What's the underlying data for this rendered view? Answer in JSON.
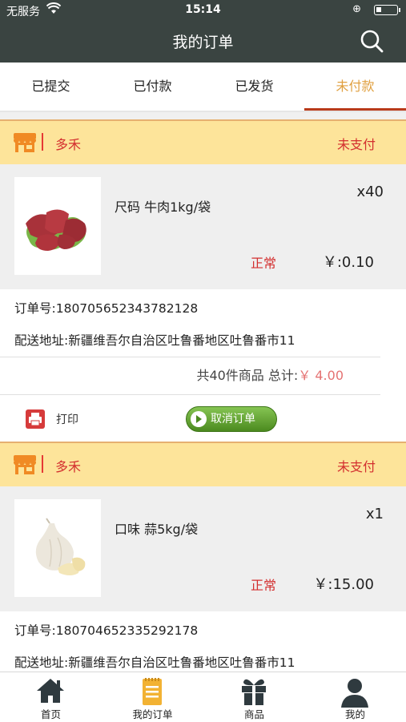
{
  "status_bar": {
    "carrier": "无服务",
    "time": "15:14"
  },
  "header": {
    "title": "我的订单"
  },
  "tabs": [
    {
      "label": "已提交"
    },
    {
      "label": "已付款"
    },
    {
      "label": "已发货"
    },
    {
      "label": "未付款"
    }
  ],
  "orders": [
    {
      "store_name": "多禾",
      "pay_status": "未支付",
      "spec": "尺码 牛肉1kg/袋",
      "quantity": "x40",
      "state": "正常",
      "price": "￥:0.10",
      "order_no": "订单号:180705652343782128",
      "address": "配送地址:新疆维吾尔自治区吐鲁番地区吐鲁番市11",
      "total_prefix": "共40件商品 总计:",
      "total_amount": "￥ 4.00",
      "print_label": "打印",
      "cancel_label": "取消订单"
    },
    {
      "store_name": "多禾",
      "pay_status": "未支付",
      "spec": "口味 蒜5kg/袋",
      "quantity": "x1",
      "state": "正常",
      "price": "￥:15.00",
      "order_no": "订单号:180704652335292178",
      "address": "配送地址:新疆维吾尔自治区吐鲁番地区吐鲁番市11"
    }
  ],
  "bottom_nav": [
    {
      "label": "首页",
      "icon": "home-icon"
    },
    {
      "label": "我的订单",
      "icon": "orders-icon"
    },
    {
      "label": "商品",
      "icon": "gift-icon"
    },
    {
      "label": "我的",
      "icon": "user-icon"
    }
  ],
  "colors": {
    "header_bg": "#3a4441",
    "accent_red": "#d32f2f",
    "tab_active": "#e0a040",
    "store_bar_bg": "#fde49a",
    "cancel_green": "#5a9a2a"
  }
}
